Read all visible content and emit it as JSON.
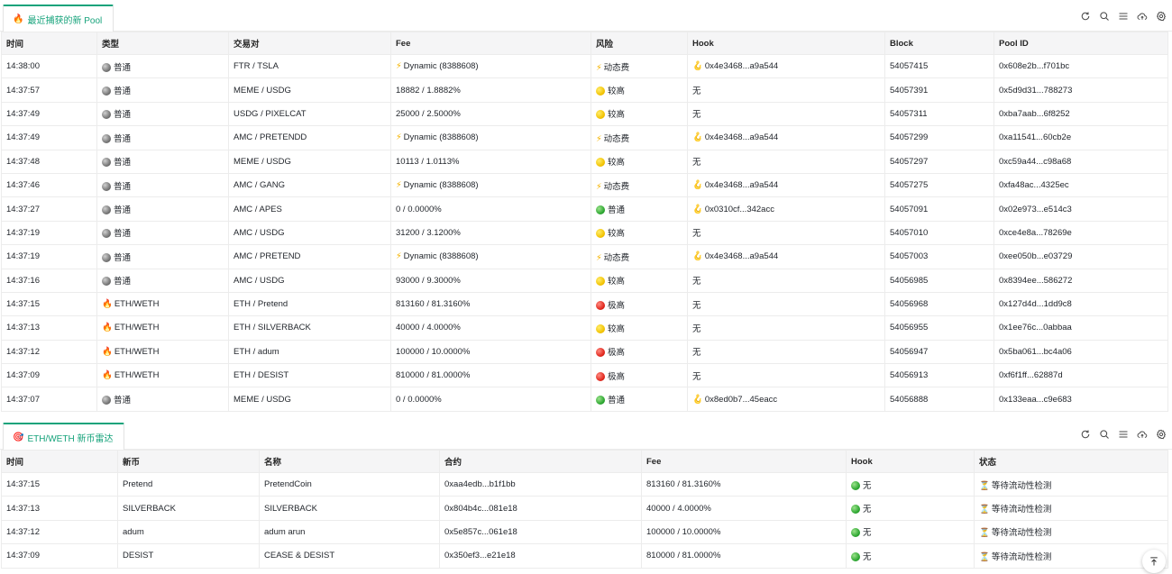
{
  "pools_panel": {
    "tab_label": "最近捕获的新 Pool",
    "tab_emoji": "🔥",
    "columns": [
      "时间",
      "类型",
      "交易对",
      "Fee",
      "风险",
      "Hook",
      "Block",
      "Pool ID"
    ],
    "rows": [
      {
        "time": "14:38:00",
        "type_icon": "grey",
        "type": "普通",
        "pair": "FTR / TSLA",
        "fee_icon": "bolt",
        "fee": "Dynamic (8388608)",
        "risk_icon": "bolt",
        "risk": "动态费",
        "hook_icon": "hook",
        "hook": "0x4e3468...a9a544",
        "block": "54057415",
        "pool_id": "0x608e2b...f701bc"
      },
      {
        "time": "14:37:57",
        "type_icon": "grey",
        "type": "普通",
        "pair": "MEME / USDG",
        "fee_icon": "",
        "fee": "18882 / 1.8882%",
        "risk_icon": "yellow",
        "risk": "较高",
        "hook_icon": "",
        "hook": "无",
        "block": "54057391",
        "pool_id": "0x5d9d31...788273"
      },
      {
        "time": "14:37:49",
        "type_icon": "grey",
        "type": "普通",
        "pair": "USDG / PIXELCAT",
        "fee_icon": "",
        "fee": "25000 / 2.5000%",
        "risk_icon": "yellow",
        "risk": "较高",
        "hook_icon": "",
        "hook": "无",
        "block": "54057311",
        "pool_id": "0xba7aab...6f8252"
      },
      {
        "time": "14:37:49",
        "type_icon": "grey",
        "type": "普通",
        "pair": "AMC / PRETENDD",
        "fee_icon": "bolt",
        "fee": "Dynamic (8388608)",
        "risk_icon": "bolt",
        "risk": "动态费",
        "hook_icon": "hook",
        "hook": "0x4e3468...a9a544",
        "block": "54057299",
        "pool_id": "0xa11541...60cb2e"
      },
      {
        "time": "14:37:48",
        "type_icon": "grey",
        "type": "普通",
        "pair": "MEME / USDG",
        "fee_icon": "",
        "fee": "10113 / 1.0113%",
        "risk_icon": "yellow",
        "risk": "较高",
        "hook_icon": "",
        "hook": "无",
        "block": "54057297",
        "pool_id": "0xc59a44...c98a68"
      },
      {
        "time": "14:37:46",
        "type_icon": "grey",
        "type": "普通",
        "pair": "AMC / GANG",
        "fee_icon": "bolt",
        "fee": "Dynamic (8388608)",
        "risk_icon": "bolt",
        "risk": "动态费",
        "hook_icon": "hook",
        "hook": "0x4e3468...a9a544",
        "block": "54057275",
        "pool_id": "0xfa48ac...4325ec"
      },
      {
        "time": "14:37:27",
        "type_icon": "grey",
        "type": "普通",
        "pair": "AMC / APES",
        "fee_icon": "",
        "fee": "0 / 0.0000%",
        "risk_icon": "green",
        "risk": "普通",
        "hook_icon": "hook",
        "hook": "0x0310cf...342acc",
        "block": "54057091",
        "pool_id": "0x02e973...e514c3"
      },
      {
        "time": "14:37:19",
        "type_icon": "grey",
        "type": "普通",
        "pair": "AMC / USDG",
        "fee_icon": "",
        "fee": "31200 / 3.1200%",
        "risk_icon": "yellow",
        "risk": "较高",
        "hook_icon": "",
        "hook": "无",
        "block": "54057010",
        "pool_id": "0xce4e8a...78269e"
      },
      {
        "time": "14:37:19",
        "type_icon": "grey",
        "type": "普通",
        "pair": "AMC / PRETEND",
        "fee_icon": "bolt",
        "fee": "Dynamic (8388608)",
        "risk_icon": "bolt",
        "risk": "动态费",
        "hook_icon": "hook",
        "hook": "0x4e3468...a9a544",
        "block": "54057003",
        "pool_id": "0xee050b...e03729"
      },
      {
        "time": "14:37:16",
        "type_icon": "grey",
        "type": "普通",
        "pair": "AMC / USDG",
        "fee_icon": "",
        "fee": "93000 / 9.3000%",
        "risk_icon": "yellow",
        "risk": "较高",
        "hook_icon": "",
        "hook": "无",
        "block": "54056985",
        "pool_id": "0x8394ee...586272"
      },
      {
        "time": "14:37:15",
        "type_icon": "fire",
        "type": "ETH/WETH",
        "pair": "ETH / Pretend",
        "fee_icon": "",
        "fee": "813160 / 81.3160%",
        "risk_icon": "red",
        "risk": "极高",
        "hook_icon": "",
        "hook": "无",
        "block": "54056968",
        "pool_id": "0x127d4d...1dd9c8"
      },
      {
        "time": "14:37:13",
        "type_icon": "fire",
        "type": "ETH/WETH",
        "pair": "ETH / SILVERBACK",
        "fee_icon": "",
        "fee": "40000 / 4.0000%",
        "risk_icon": "yellow",
        "risk": "较高",
        "hook_icon": "",
        "hook": "无",
        "block": "54056955",
        "pool_id": "0x1ee76c...0abbaa"
      },
      {
        "time": "14:37:12",
        "type_icon": "fire",
        "type": "ETH/WETH",
        "pair": "ETH / adum",
        "fee_icon": "",
        "fee": "100000 / 10.0000%",
        "risk_icon": "red",
        "risk": "极高",
        "hook_icon": "",
        "hook": "无",
        "block": "54056947",
        "pool_id": "0x5ba061...bc4a06"
      },
      {
        "time": "14:37:09",
        "type_icon": "fire",
        "type": "ETH/WETH",
        "pair": "ETH / DESIST",
        "fee_icon": "",
        "fee": "810000 / 81.0000%",
        "risk_icon": "red",
        "risk": "极高",
        "hook_icon": "",
        "hook": "无",
        "block": "54056913",
        "pool_id": "0xf6f1ff...62887d"
      },
      {
        "time": "14:37:07",
        "type_icon": "grey",
        "type": "普通",
        "pair": "MEME / USDG",
        "fee_icon": "",
        "fee": "0 / 0.0000%",
        "risk_icon": "green",
        "risk": "普通",
        "hook_icon": "hook",
        "hook": "0x8ed0b7...45eacc",
        "block": "54056888",
        "pool_id": "0x133eaa...c9e683"
      }
    ]
  },
  "radar_panel": {
    "tab_label": "ETH/WETH 新币雷达",
    "tab_emoji": "🎯",
    "columns": [
      "时间",
      "新币",
      "名称",
      "合约",
      "Fee",
      "Hook",
      "状态"
    ],
    "rows": [
      {
        "time": "14:37:15",
        "token": "Pretend",
        "name": "PretendCoin",
        "contract": "0xaa4edb...b1f1bb",
        "fee": "813160 / 81.3160%",
        "hook": "无",
        "status": "等待流动性检测"
      },
      {
        "time": "14:37:13",
        "token": "SILVERBACK",
        "name": "SILVERBACK",
        "contract": "0x804b4c...081e18",
        "fee": "40000 / 4.0000%",
        "hook": "无",
        "status": "等待流动性检测"
      },
      {
        "time": "14:37:12",
        "token": "adum",
        "name": "adum arun",
        "contract": "0x5e857c...061e18",
        "fee": "100000 / 10.0000%",
        "hook": "无",
        "status": "等待流动性检测"
      },
      {
        "time": "14:37:09",
        "token": "DESIST",
        "name": "CEASE & DESIST",
        "contract": "0x350ef3...e21e18",
        "fee": "810000 / 81.0000%",
        "hook": "无",
        "status": "等待流动性检测"
      }
    ]
  },
  "toolbar_icons": [
    "refresh-icon",
    "search-icon",
    "menu-icon",
    "cloud-upload-icon",
    "settings-icon"
  ],
  "colors": {
    "accent": "#16a37b",
    "header_bg": "#f5f5f6"
  }
}
